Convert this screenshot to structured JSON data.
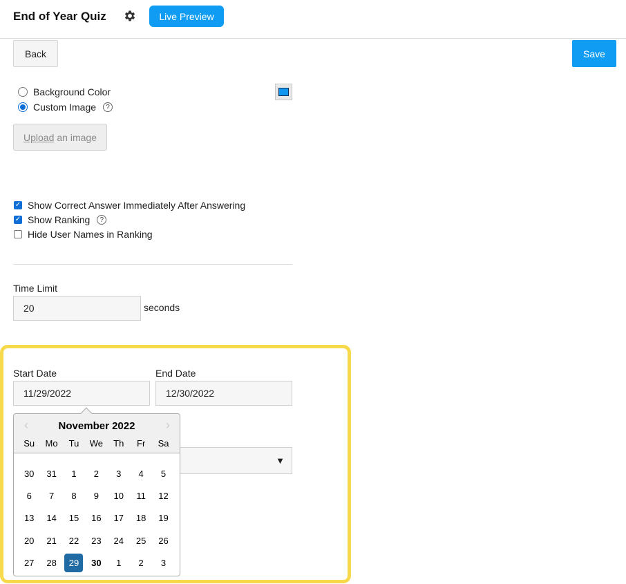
{
  "header": {
    "title": "End of Year Quiz",
    "settings_icon": "gear-icon",
    "live_preview_label": "Live Preview"
  },
  "toolbar": {
    "back_label": "Back",
    "save_label": "Save"
  },
  "background": {
    "options": [
      {
        "label": "Background Color",
        "selected": false
      },
      {
        "label": "Custom Image",
        "selected": true
      }
    ],
    "color_swatch": "#1196f0",
    "upload_link": "Upload",
    "upload_rest": "an image"
  },
  "checkboxes": [
    {
      "label": "Show Correct Answer Immediately After Answering",
      "checked": true
    },
    {
      "label": "Show Ranking",
      "checked": true
    },
    {
      "label": "Hide User Names in Ranking",
      "checked": false
    }
  ],
  "time_limit": {
    "label": "Time Limit",
    "value": "20",
    "unit": "seconds"
  },
  "dates": {
    "start_label": "Start Date",
    "start_value": "11/29/2022",
    "end_label": "End Date",
    "end_value": "12/30/2022"
  },
  "datepicker": {
    "month_label": "November 2022",
    "weekdays": [
      "Su",
      "Mo",
      "Tu",
      "We",
      "Th",
      "Fr",
      "Sa"
    ],
    "weeks": [
      [
        "30",
        "31",
        "1",
        "2",
        "3",
        "4",
        "5"
      ],
      [
        "6",
        "7",
        "8",
        "9",
        "10",
        "11",
        "12"
      ],
      [
        "13",
        "14",
        "15",
        "16",
        "17",
        "18",
        "19"
      ],
      [
        "20",
        "21",
        "22",
        "23",
        "24",
        "25",
        "26"
      ],
      [
        "27",
        "28",
        "29",
        "30",
        "1",
        "2",
        "3"
      ]
    ],
    "selected_day": "29",
    "bold_day": "30"
  },
  "colors": {
    "accent": "#0f9cf2",
    "highlight_border": "#f7d94c",
    "selected_day": "#216ba5"
  }
}
